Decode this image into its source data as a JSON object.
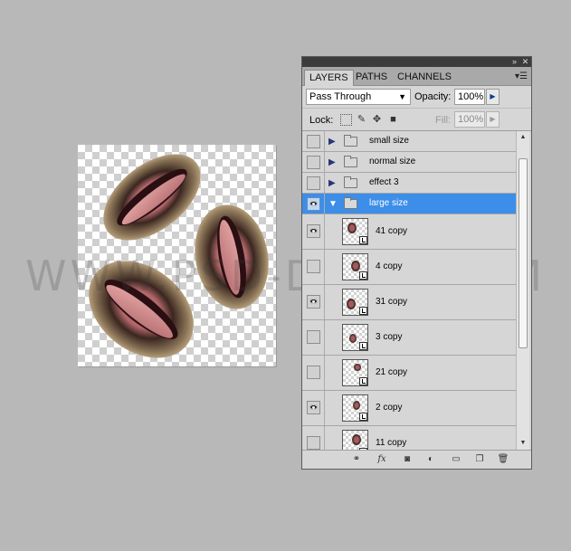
{
  "watermark": "WWW.PSD-DUDE.COM",
  "panel": {
    "tabs": [
      "LAYERS",
      "PATHS",
      "CHANNELS"
    ],
    "blend_mode": "Pass Through",
    "opacity_label": "Opacity:",
    "opacity_value": "100%",
    "lock_label": "Lock:",
    "fill_label": "Fill:",
    "fill_value": "100%",
    "icons": {
      "collapse": "double-right-arrow-icon",
      "close": "close-icon",
      "panel_menu": "panel-menu-icon",
      "lock_transparent": "lock-transparent-pixels-icon",
      "lock_image": "brush-icon",
      "lock_position": "move-icon",
      "lock_all": "lock-icon"
    },
    "layers": [
      {
        "type": "group",
        "name": "small size",
        "visible": false,
        "expanded": false,
        "selected": false
      },
      {
        "type": "group",
        "name": "normal size",
        "visible": false,
        "expanded": false,
        "selected": false
      },
      {
        "type": "group",
        "name": "effect 3",
        "visible": false,
        "expanded": false,
        "selected": false
      },
      {
        "type": "group",
        "name": "large size",
        "visible": true,
        "expanded": true,
        "selected": true
      },
      {
        "type": "layer",
        "name": "41 copy",
        "visible": true
      },
      {
        "type": "layer",
        "name": "4 copy",
        "visible": false
      },
      {
        "type": "layer",
        "name": "31 copy",
        "visible": true
      },
      {
        "type": "layer",
        "name": "3 copy",
        "visible": false
      },
      {
        "type": "layer",
        "name": "21 copy",
        "visible": false
      },
      {
        "type": "layer",
        "name": "2 copy",
        "visible": true
      },
      {
        "type": "layer",
        "name": "11 copy",
        "visible": false
      }
    ],
    "footer_icons": [
      "link-layers-icon",
      "fx-icon",
      "add-mask-icon",
      "adjustment-layer-icon",
      "new-group-icon",
      "new-layer-icon",
      "trash-icon"
    ]
  }
}
